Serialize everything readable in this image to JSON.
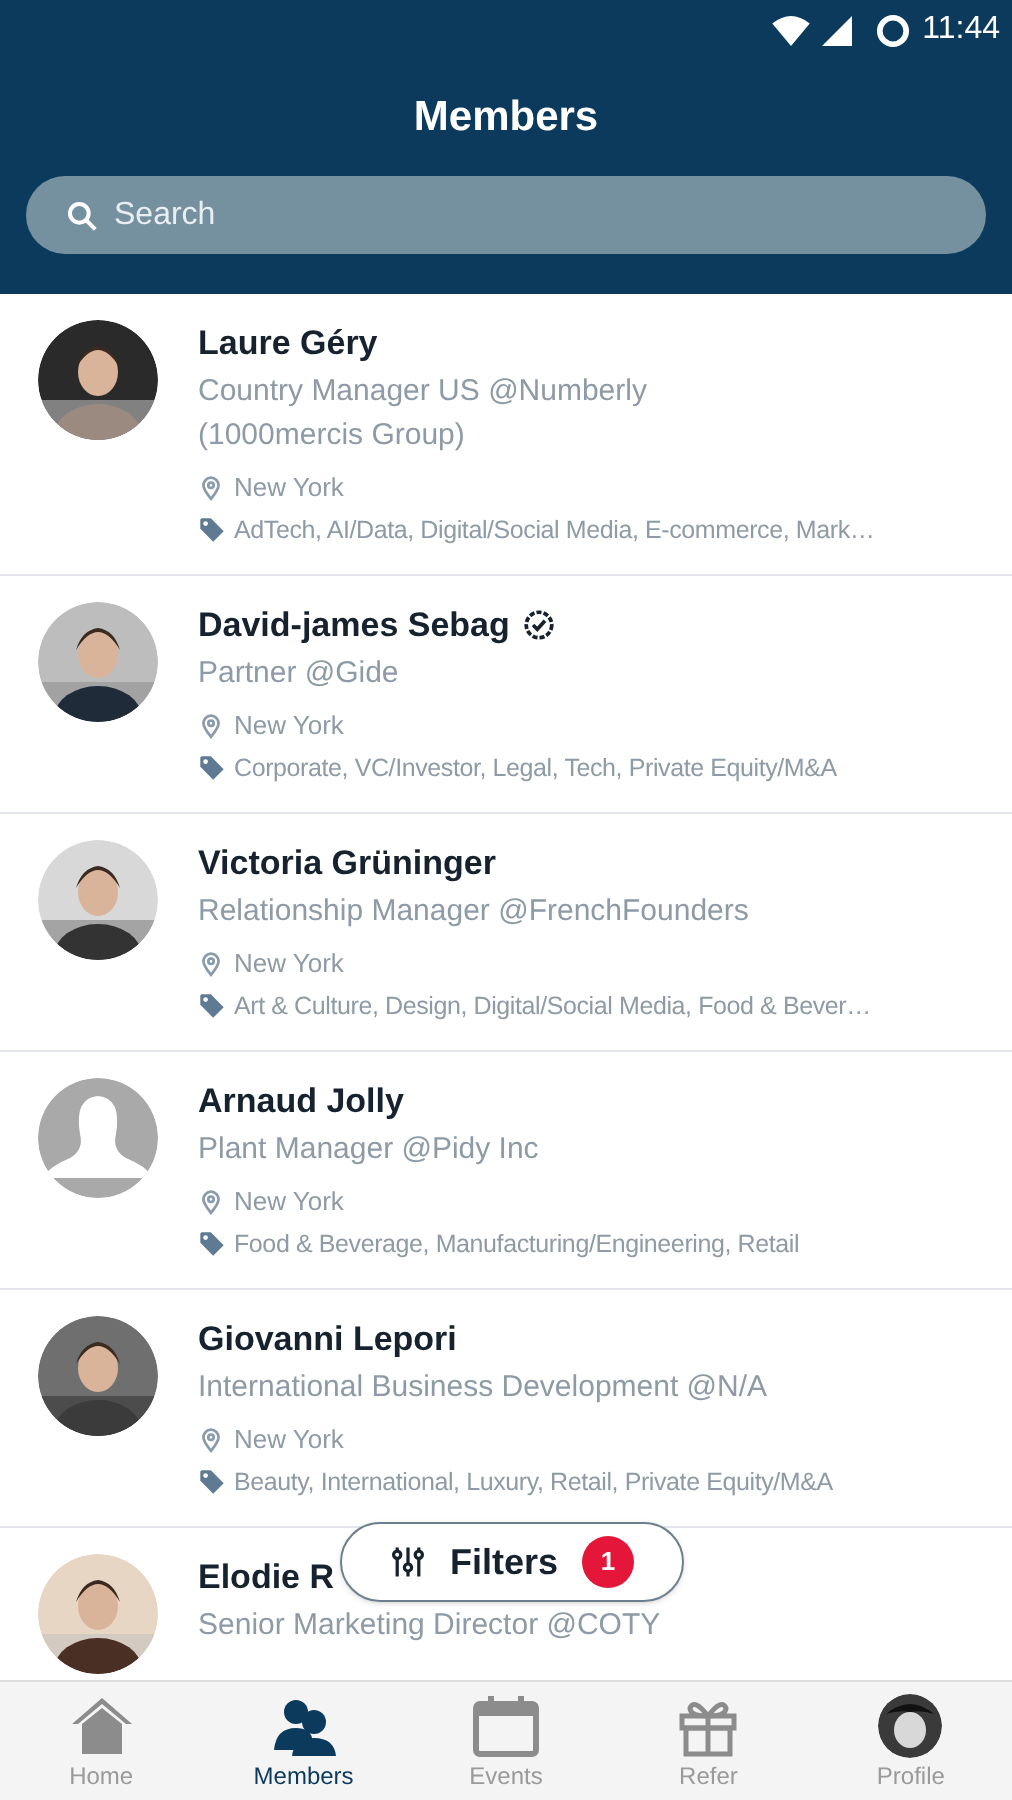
{
  "status_bar": {
    "time": "11:44"
  },
  "header": {
    "title": "Members"
  },
  "search": {
    "placeholder": "Search"
  },
  "members": [
    {
      "name": "Laure Géry",
      "verified": false,
      "title": "Country Manager US @Numberly (1000mercis Group)",
      "location": "New York",
      "tags": "AdTech, AI/Data, Digital/Social Media, E-commerce, Mark…"
    },
    {
      "name": "David-james Sebag",
      "verified": true,
      "title": "Partner @Gide",
      "location": "New York",
      "tags": "Corporate, VC/Investor, Legal, Tech, Private Equity/M&A"
    },
    {
      "name": "Victoria Grüninger",
      "verified": false,
      "title": "Relationship Manager @FrenchFounders",
      "location": "New York",
      "tags": "Art & Culture, Design, Digital/Social Media, Food & Bever…"
    },
    {
      "name": "Arnaud Jolly",
      "verified": false,
      "kind": "placeholder",
      "title": "Plant Manager @Pidy Inc",
      "location": "New York",
      "tags": "Food & Beverage, Manufacturing/Engineering, Retail"
    },
    {
      "name": "Giovanni Lepori",
      "verified": false,
      "title": "International Business Development @N/A",
      "location": "New York",
      "tags": "Beauty, International, Luxury, Retail, Private Equity/M&A"
    },
    {
      "name": "Elodie R",
      "verified": false,
      "title": "Senior Marketing Director @COTY"
    }
  ],
  "filters_button": {
    "label": "Filters",
    "count": "1"
  },
  "bottom_nav": [
    {
      "kind": "home",
      "label": "Home",
      "selected": false
    },
    {
      "kind": "members",
      "label": "Members",
      "selected": true
    },
    {
      "kind": "events",
      "label": "Events",
      "selected": false
    },
    {
      "kind": "refer",
      "label": "Refer",
      "selected": false
    },
    {
      "kind": "profile",
      "label": "Profile",
      "selected": false
    }
  ]
}
